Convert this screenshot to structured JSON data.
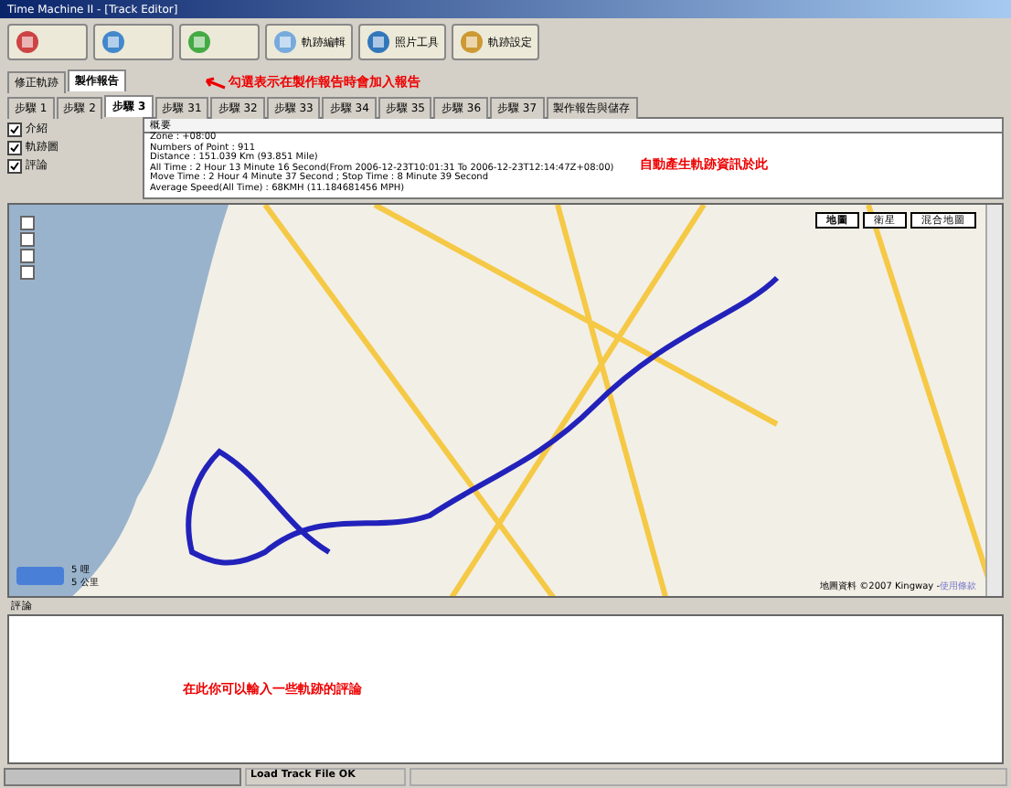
{
  "window": {
    "title": "Time Machine II - [Track Editor]"
  },
  "toolbar": [
    {
      "kind": "icon"
    },
    {
      "kind": "icon"
    },
    {
      "kind": "icon"
    },
    {
      "kind": "labeled",
      "label": "軌跡編輯"
    },
    {
      "kind": "labeled",
      "label": "照片工具"
    },
    {
      "kind": "labeled",
      "label": "軌跡設定"
    }
  ],
  "tabs": [
    {
      "label": "修正軌跡",
      "selected": false
    },
    {
      "label": "製作報告",
      "selected": true
    }
  ],
  "step_tabs": [
    {
      "label": "步驟 1",
      "selected": false
    },
    {
      "label": "步驟 2",
      "selected": false
    },
    {
      "label": "步驟 3",
      "selected": true
    },
    {
      "label": "步驟 31",
      "selected": false
    },
    {
      "label": "步驟 32",
      "selected": false
    },
    {
      "label": "步驟 33",
      "selected": false
    },
    {
      "label": "步驟 34",
      "selected": false
    },
    {
      "label": "步驟 35",
      "selected": false
    },
    {
      "label": "步驟 36",
      "selected": false
    },
    {
      "label": "步驟 37",
      "selected": false
    },
    {
      "label": "製作報告與儲存",
      "selected": false
    }
  ],
  "sections": [
    {
      "label": "介紹",
      "checked": true
    },
    {
      "label": "軌跡圖",
      "checked": true
    },
    {
      "label": "評論",
      "checked": true
    }
  ],
  "callouts": {
    "sections": "勾選表示在製作報告時會加入報告",
    "summary": "自動產生軌跡資訊於此",
    "comment": "在此你可以輸入一些軌跡的評論"
  },
  "summary": {
    "title": "概要",
    "lines": [
      "Zone : +08:00",
      "Numbers of Point : 911",
      "Distance : 151.039 Km (93.851 Mile)",
      "All Time : 2 Hour 13 Minute 16 Second(From 2006-12-23T10:01:31 To 2006-12-23T12:14:47Z+08:00)",
      "Move Time : 2 Hour 4 Minute 37 Second ; Stop Time : 8 Minute 39 Second",
      "Average Speed(All Time) : 68KMH  (11.184681456 MPH)"
    ]
  },
  "map": {
    "types": [
      {
        "label": "地圖",
        "selected": true
      },
      {
        "label": "衛星",
        "selected": false
      },
      {
        "label": "混合地圖",
        "selected": false
      }
    ],
    "scale": [
      "5 哩",
      "5 公里"
    ],
    "attribution": "地圖資料 ©2007 Kingway - ",
    "terms": "使用條款"
  },
  "comment": {
    "label": "評論"
  },
  "status_bar": {
    "message": "Load Track File OK"
  }
}
